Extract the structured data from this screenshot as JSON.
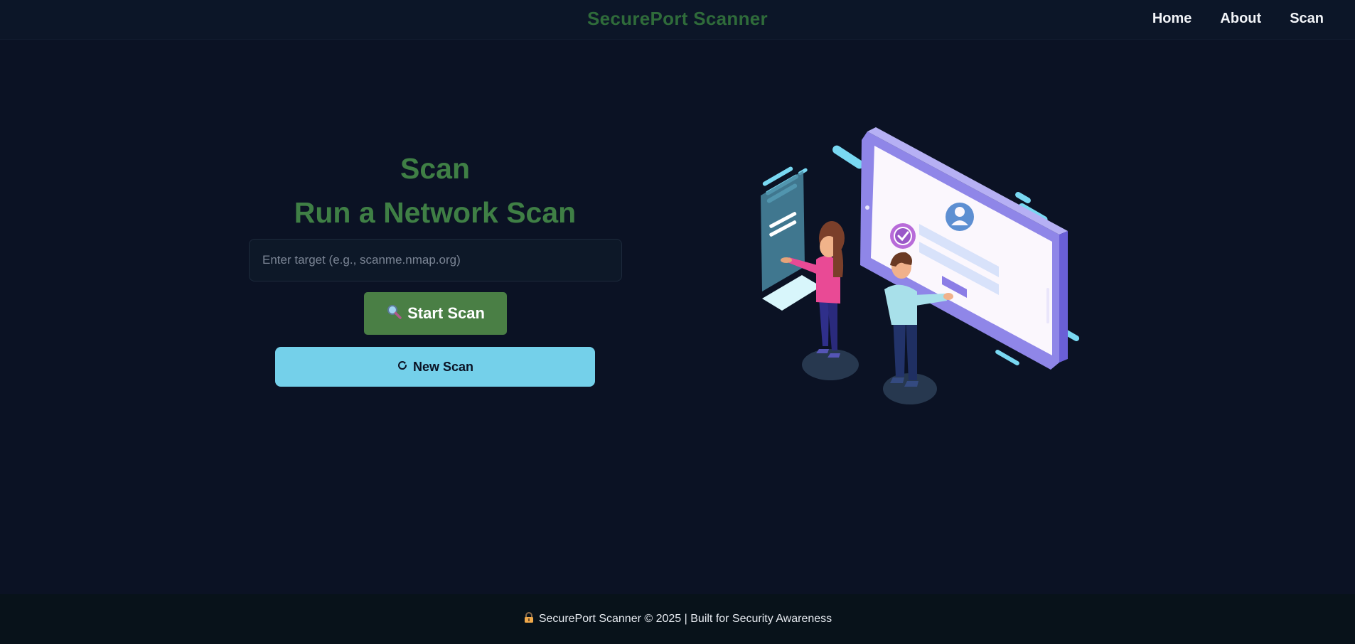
{
  "header": {
    "brand": "SecurePort Scanner",
    "nav": [
      "Home",
      "About",
      "Scan"
    ]
  },
  "main": {
    "title": "Scan",
    "subtitle": "Run a Network Scan",
    "target_placeholder": "Enter target (e.g., scanme.nmap.org)",
    "target_value": "",
    "start_label": "Start Scan",
    "start_icon": "magnifier-icon",
    "new_label": "New Scan",
    "new_icon": "refresh-icon"
  },
  "footer": {
    "icon": "lock-icon",
    "text": "SecurePort Scanner © 2025 | Built for Security Awareness"
  },
  "colors": {
    "background": "#0b1224",
    "brand_green": "#3f7f45",
    "button_green": "#4a7f45",
    "button_cyan": "#74d0ea"
  }
}
